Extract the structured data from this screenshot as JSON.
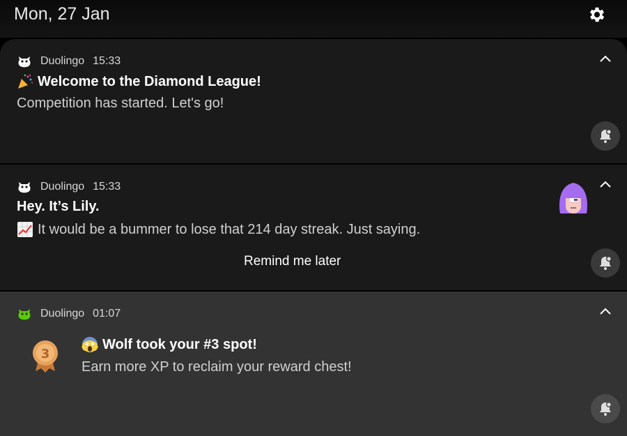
{
  "status_bar": {
    "date": "Mon, 27 Jan"
  },
  "notifications": [
    {
      "app": "Duolingo",
      "time": "15:33",
      "title_emoji": "party-popper",
      "title": "Welcome to the Diamond League!",
      "body": "Competition has started. Let's go!"
    },
    {
      "app": "Duolingo",
      "time": "15:33",
      "title": "Hey. It’s Lily.",
      "body_emoji": "chart-increasing",
      "body": "It would be a bummer to lose that 214 day streak. Just saying.",
      "action": "Remind me later"
    },
    {
      "app": "Duolingo",
      "time": "01:07",
      "title_emoji": "face-screaming",
      "title": "Wolf took your #3 spot!",
      "body": "Earn more XP to reclaim your reward chest!",
      "badge": "3"
    }
  ],
  "colors": {
    "card": "#1a1a1a",
    "card_highlight": "#333333",
    "duolingo_green": "#58cc02",
    "lily_purple": "#a56cf0",
    "bronze": "#e8a15c"
  }
}
